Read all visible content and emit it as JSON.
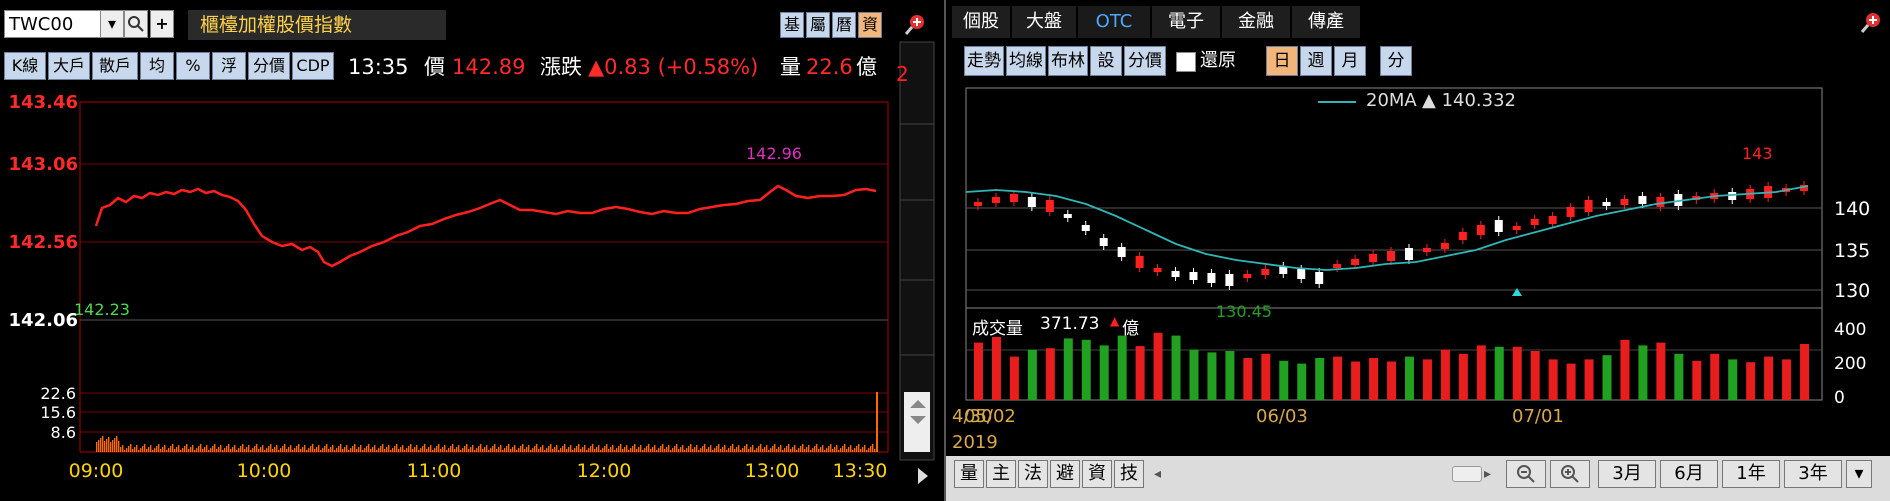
{
  "left_panel": {
    "symbol": "TWC00",
    "dropdown_glyph": "▾",
    "search_glyph": "🔍",
    "plus_glyph": "+",
    "title": "櫃檯加權股價指數",
    "right_buttons": [
      "基",
      "屬",
      "曆",
      "資"
    ],
    "active_right_button": "資",
    "toolbar": [
      "K線",
      "大戶",
      "散戶",
      "均",
      "%",
      "浮",
      "分價",
      "CDP"
    ],
    "time": "13:35",
    "price_label": "價",
    "price": "142.89",
    "change_label": "漲跌",
    "change": "▲0.83 (+0.58%)",
    "volume_label": "量",
    "volume": "22.6",
    "volume_unit": "億",
    "y_labels": [
      "143.46",
      "143.06",
      "142.56",
      "142.06"
    ],
    "high_annotation": "142.96",
    "ref_annotation": "142.23",
    "vol_labels": [
      "22.6",
      "15.6",
      "8.6"
    ],
    "x_labels": [
      "09:00",
      "10:00",
      "11:00",
      "12:00",
      "13:00",
      "13:30"
    ],
    "side_glyph": "2",
    "colors": {
      "up": "#ff2b2b",
      "axis_line": "#b00000",
      "grid": "#7a0000",
      "title_text": "#ffd24a"
    }
  },
  "right_panel": {
    "tabs": [
      "個股",
      "大盤",
      "OTC",
      "電子",
      "金融",
      "傳產"
    ],
    "active_tab": "OTC",
    "toolbar": [
      "走勢",
      "均線",
      "布林",
      "設",
      "分價"
    ],
    "restore_label": "還原",
    "period_buttons": [
      "日",
      "週",
      "月"
    ],
    "active_period": "日",
    "minute_button": "分",
    "ma_legend": "20MA",
    "ma_value": "▲ 140.332",
    "price_axis": [
      "140",
      "135",
      "130"
    ],
    "high_label": "143",
    "low_label": "130.45",
    "volume_label": "成交量",
    "volume_value": "371.73",
    "volume_unit": "億",
    "volume_axis": [
      "400",
      "200",
      "0"
    ],
    "date_labels": [
      "05/02",
      "06/03",
      "07/01"
    ],
    "overlap_date": "4/30",
    "year": "2019",
    "bottom_buttons": [
      "量",
      "主",
      "法",
      "避",
      "資",
      "技"
    ],
    "range_buttons": [
      "3月",
      "6月",
      "1年",
      "3年"
    ],
    "zoom_out": "−",
    "zoom_in": "+",
    "colors": {
      "up": "#ff2020",
      "down": "#ffffff",
      "ma": "#2fb7b7",
      "vol_up": "#e81e1e",
      "vol_down": "#22a022"
    }
  }
}
